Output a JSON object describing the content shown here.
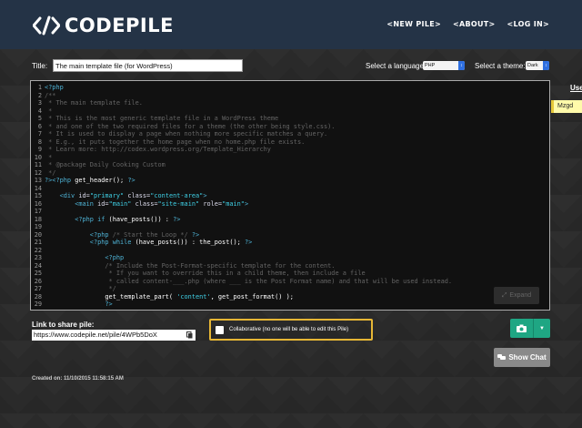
{
  "header": {
    "brand": "CODEPILE",
    "nav": [
      "<NEW PILE>",
      "<ABOUT>",
      "<LOG IN>"
    ]
  },
  "controls": {
    "title_label": "Title:",
    "title_value": "The main template file (for WordPress)",
    "language_label": "Select a language:",
    "language_value": "PHP",
    "theme_label": "Select a theme:",
    "theme_value": "Dark"
  },
  "editor": {
    "lines": [
      {
        "n": "1",
        "parts": [
          [
            "kw",
            "<?php"
          ]
        ]
      },
      {
        "n": "2",
        "parts": [
          [
            "comment",
            "/**"
          ]
        ]
      },
      {
        "n": "3",
        "parts": [
          [
            "comment",
            " * The main template file."
          ]
        ]
      },
      {
        "n": "4",
        "parts": [
          [
            "comment",
            " *"
          ]
        ]
      },
      {
        "n": "5",
        "parts": [
          [
            "comment",
            " * This is the most generic template file in a WordPress theme"
          ]
        ]
      },
      {
        "n": "6",
        "parts": [
          [
            "comment",
            " * and one of the two required files for a theme (the other being style.css)."
          ]
        ]
      },
      {
        "n": "7",
        "parts": [
          [
            "comment",
            " * It is used to display a page when nothing more specific matches a query."
          ]
        ]
      },
      {
        "n": "8",
        "parts": [
          [
            "comment",
            " * E.g., it puts together the home page when no home.php file exists."
          ]
        ]
      },
      {
        "n": "9",
        "parts": [
          [
            "comment",
            " * Learn more: http://codex.wordpress.org/Template_Hierarchy"
          ]
        ]
      },
      {
        "n": "10",
        "parts": [
          [
            "comment",
            " *"
          ]
        ]
      },
      {
        "n": "11",
        "parts": [
          [
            "comment",
            " * @package Daily Cooking Custom"
          ]
        ]
      },
      {
        "n": "12",
        "parts": [
          [
            "comment",
            " */"
          ]
        ]
      },
      {
        "n": "13",
        "parts": [
          [
            "kw",
            "?><?php "
          ],
          [
            "fn",
            "get_header"
          ],
          [
            "plain",
            "(); "
          ],
          [
            "kw",
            "?>"
          ]
        ]
      },
      {
        "n": "14",
        "parts": [
          [
            "plain",
            ""
          ]
        ]
      },
      {
        "n": "15",
        "parts": [
          [
            "plain",
            "    "
          ],
          [
            "kw",
            "<div "
          ],
          [
            "attr",
            "id="
          ],
          [
            "str",
            "\"primary\" "
          ],
          [
            "attr",
            "class="
          ],
          [
            "str",
            "\"content-area\""
          ],
          [
            "kw",
            ">"
          ]
        ]
      },
      {
        "n": "16",
        "parts": [
          [
            "plain",
            "        "
          ],
          [
            "kw",
            "<main "
          ],
          [
            "attr",
            "id="
          ],
          [
            "str",
            "\"main\" "
          ],
          [
            "attr",
            "class="
          ],
          [
            "str",
            "\"site-main\" "
          ],
          [
            "attr",
            "role="
          ],
          [
            "str",
            "\"main\""
          ],
          [
            "kw",
            ">"
          ]
        ]
      },
      {
        "n": "17",
        "parts": [
          [
            "plain",
            ""
          ]
        ]
      },
      {
        "n": "18",
        "parts": [
          [
            "plain",
            "        "
          ],
          [
            "kw",
            "<?php if "
          ],
          [
            "plain",
            "("
          ],
          [
            "fn",
            "have_posts"
          ],
          [
            "plain",
            "()) : "
          ],
          [
            "kw",
            "?>"
          ]
        ]
      },
      {
        "n": "19",
        "parts": [
          [
            "plain",
            ""
          ]
        ]
      },
      {
        "n": "20",
        "parts": [
          [
            "plain",
            "            "
          ],
          [
            "kw",
            "<?php "
          ],
          [
            "comment",
            "/* Start the Loop */ "
          ],
          [
            "kw",
            "?>"
          ]
        ]
      },
      {
        "n": "21",
        "parts": [
          [
            "plain",
            "            "
          ],
          [
            "kw",
            "<?php while "
          ],
          [
            "plain",
            "("
          ],
          [
            "fn",
            "have_posts"
          ],
          [
            "plain",
            "()) : "
          ],
          [
            "fn",
            "the_post"
          ],
          [
            "plain",
            "(); "
          ],
          [
            "kw",
            "?>"
          ]
        ]
      },
      {
        "n": "22",
        "parts": [
          [
            "plain",
            ""
          ]
        ]
      },
      {
        "n": "23",
        "parts": [
          [
            "plain",
            "                "
          ],
          [
            "kw",
            "<?php"
          ]
        ]
      },
      {
        "n": "24",
        "parts": [
          [
            "plain",
            "                "
          ],
          [
            "comment",
            "/* Include the Post-Format-specific template for the content."
          ]
        ]
      },
      {
        "n": "25",
        "parts": [
          [
            "plain",
            "                 "
          ],
          [
            "comment",
            "* If you want to override this in a child theme, then include a file"
          ]
        ]
      },
      {
        "n": "26",
        "parts": [
          [
            "plain",
            "                 "
          ],
          [
            "comment",
            "* called content-___.php (where ___ is the Post Format name) and that will be used instead."
          ]
        ]
      },
      {
        "n": "27",
        "parts": [
          [
            "plain",
            "                 "
          ],
          [
            "comment",
            "*/"
          ]
        ]
      },
      {
        "n": "28",
        "parts": [
          [
            "plain",
            "                "
          ],
          [
            "fn",
            "get_template_part"
          ],
          [
            "plain",
            "( "
          ],
          [
            "str",
            "'content'"
          ],
          [
            "plain",
            ", "
          ],
          [
            "fn",
            "get_post_format"
          ],
          [
            "plain",
            "() );"
          ]
        ]
      },
      {
        "n": "29",
        "parts": [
          [
            "plain",
            "                "
          ],
          [
            "kw",
            "?>"
          ]
        ]
      }
    ],
    "expand_label": "Expand"
  },
  "users": {
    "title": "Use",
    "active_user": "Mzgd"
  },
  "share": {
    "label": "Link to share pile:",
    "url": "https://www.codepile.net/pile/4WPb5DoX"
  },
  "collab": {
    "label": "Collaborative (no one will be able to edit this Pile)"
  },
  "chat": {
    "label": "Show Chat"
  },
  "meta": {
    "created": "Created on: 11/10/2015 11:58:15 AM"
  },
  "colors": {
    "header_bg": "#243346",
    "accent_green": "#1fa683",
    "collab_border": "#e6b635",
    "select_blue": "#2f6fe0"
  }
}
